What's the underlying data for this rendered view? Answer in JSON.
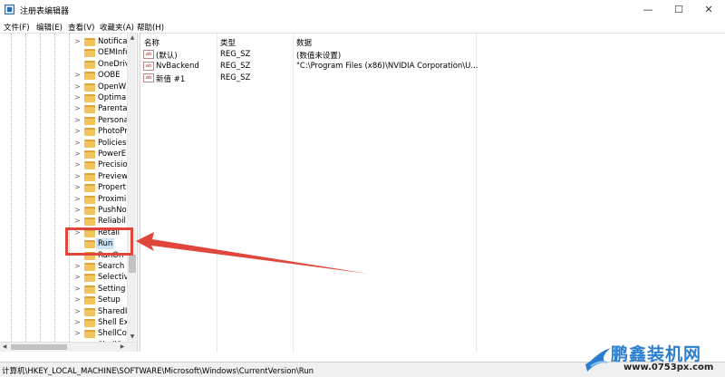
{
  "window": {
    "title": "注册表编辑器",
    "minimize_glyph": "—",
    "maximize_glyph": "☐",
    "close_glyph": "✕"
  },
  "menu": [
    "文件(F)",
    "编辑(E)",
    "查看(V)",
    "收藏夹(A)",
    "帮助(H)"
  ],
  "tree": {
    "items": [
      {
        "label": "Notifica",
        "expandable": true
      },
      {
        "label": "OEMInfo",
        "expandable": false
      },
      {
        "label": "OneDriv",
        "expandable": false
      },
      {
        "label": "OOBE",
        "expandable": true
      },
      {
        "label": "OpenW",
        "expandable": true
      },
      {
        "label": "Optimal",
        "expandable": true
      },
      {
        "label": "Parenta",
        "expandable": true
      },
      {
        "label": "Persona",
        "expandable": true
      },
      {
        "label": "PhotoPr",
        "expandable": true
      },
      {
        "label": "Policies",
        "expandable": true
      },
      {
        "label": "PowerE",
        "expandable": true
      },
      {
        "label": "Precisio",
        "expandable": true
      },
      {
        "label": "Preview",
        "expandable": true
      },
      {
        "label": "Propert",
        "expandable": true
      },
      {
        "label": "Proximi",
        "expandable": true
      },
      {
        "label": "PushNo",
        "expandable": true
      },
      {
        "label": "Reliabil",
        "expandable": true
      },
      {
        "label": "Retail",
        "expandable": true
      },
      {
        "label": "Run",
        "expandable": false,
        "selected": true
      },
      {
        "label": "RunOn",
        "expandable": false
      },
      {
        "label": "Search",
        "expandable": true
      },
      {
        "label": "Selectiv",
        "expandable": true
      },
      {
        "label": "Setting",
        "expandable": true
      },
      {
        "label": "Setup",
        "expandable": true
      },
      {
        "label": "SharedI",
        "expandable": true
      },
      {
        "label": "Shell Ex",
        "expandable": true
      },
      {
        "label": "ShellCo",
        "expandable": true
      },
      {
        "label": "ShellSer",
        "expandable": true
      }
    ]
  },
  "values": {
    "columns": [
      "名称",
      "类型",
      "数据"
    ],
    "rows": [
      {
        "name": "(默认)",
        "type": "REG_SZ",
        "data": "(数值未设置)"
      },
      {
        "name": "NvBackend",
        "type": "REG_SZ",
        "data": "\"C:\\Program Files (x86)\\NVIDIA Corporation\\U..."
      },
      {
        "name": "新值 #1",
        "type": "REG_SZ",
        "data": ""
      }
    ],
    "icon_text": "ab"
  },
  "status": {
    "path": "计算机\\HKEY_LOCAL_MACHINE\\SOFTWARE\\Microsoft\\Windows\\CurrentVersion\\Run"
  },
  "watermark": {
    "title": "鹏鑫装机网",
    "url": "www.0753px.com"
  },
  "colors": {
    "annotation_red": "#e0463c",
    "selection_blue": "#cde4f7",
    "folder_yellow": "#f2c55c"
  }
}
